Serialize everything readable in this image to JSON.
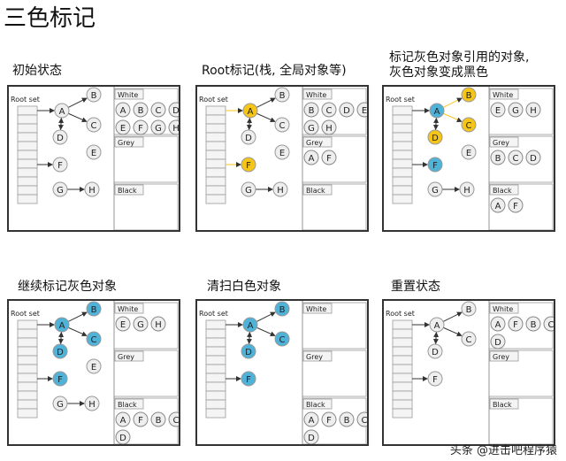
{
  "title": "三色标记",
  "watermark": "头条 @进击吧程序猿",
  "labels": {
    "root_set": "Root set",
    "white": "White",
    "grey": "Grey",
    "black": "Black"
  },
  "colors": {
    "white_node": "#eeeeee",
    "grey_node": "#f5c518",
    "black_node": "#4fb3d9",
    "edge": "#333333",
    "grey_edge": "#f5c518"
  },
  "panels": [
    {
      "title": "初始状态",
      "nodes": {
        "A": "white",
        "B": "white",
        "C": "white",
        "D": "white",
        "E": "white",
        "F": "white",
        "G": "white",
        "H": "white"
      },
      "white_set": [
        "A",
        "B",
        "C",
        "D",
        "E",
        "F",
        "G",
        "H"
      ],
      "grey_set": [],
      "black_set": []
    },
    {
      "title": "Root标记(栈, 全局对象等)",
      "nodes": {
        "A": "grey",
        "B": "white",
        "C": "white",
        "D": "white",
        "E": "white",
        "F": "grey",
        "G": "white",
        "H": "white"
      },
      "white_set": [
        "B",
        "C",
        "D",
        "E",
        "G",
        "H"
      ],
      "grey_set": [
        "A",
        "F"
      ],
      "black_set": []
    },
    {
      "title": "标记灰色对象引用的对象,\n灰色对象变成黑色",
      "nodes": {
        "A": "black",
        "B": "grey",
        "C": "grey",
        "D": "grey",
        "E": "white",
        "F": "black",
        "G": "white",
        "H": "white"
      },
      "white_set": [
        "E",
        "G",
        "H"
      ],
      "grey_set": [
        "B",
        "C",
        "D"
      ],
      "black_set": [
        "A",
        "F"
      ]
    },
    {
      "title": "继续标记灰色对象",
      "nodes": {
        "A": "black",
        "B": "black",
        "C": "black",
        "D": "black",
        "E": "white",
        "F": "black",
        "G": "white",
        "H": "white"
      },
      "white_set": [
        "E",
        "G",
        "H"
      ],
      "grey_set": [],
      "black_set": [
        "A",
        "F",
        "B",
        "C",
        "D"
      ]
    },
    {
      "title": "清扫白色对象",
      "nodes": {
        "A": "black",
        "B": "black",
        "C": "black",
        "D": "black",
        "F": "black"
      },
      "white_set": [],
      "grey_set": [],
      "black_set": [
        "A",
        "F",
        "B",
        "C",
        "D"
      ]
    },
    {
      "title": "重置状态",
      "nodes": {
        "A": "white",
        "B": "white",
        "C": "white",
        "D": "white",
        "F": "white"
      },
      "white_set": [
        "A",
        "F",
        "B",
        "C",
        "D"
      ],
      "grey_set": [],
      "black_set": []
    }
  ]
}
